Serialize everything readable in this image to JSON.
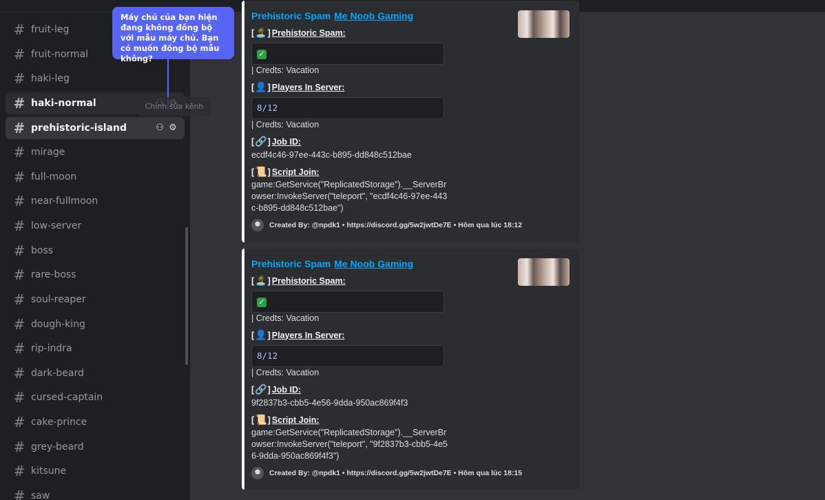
{
  "sidebar": {
    "channels": [
      {
        "name": "fruit-leg"
      },
      {
        "name": "fruit-normal"
      },
      {
        "name": "haki-leg"
      },
      {
        "name": "haki-normal"
      },
      {
        "name": "prehistoric-island"
      },
      {
        "name": "mirage"
      },
      {
        "name": "full-moon"
      },
      {
        "name": "near-fullmoon"
      },
      {
        "name": "low-server"
      },
      {
        "name": "boss"
      },
      {
        "name": "rare-boss"
      },
      {
        "name": "soul-reaper"
      },
      {
        "name": "dough-king"
      },
      {
        "name": "rip-indra"
      },
      {
        "name": "dark-beard"
      },
      {
        "name": "cursed-captain"
      },
      {
        "name": "cake-prince"
      },
      {
        "name": "grey-beard"
      },
      {
        "name": "kitsune"
      },
      {
        "name": "saw"
      }
    ],
    "hash_symbol": "#",
    "tooltip": "Chỉnh sửa kênh"
  },
  "popup": {
    "text": "Máy chủ của bạn hiện đang không đồng bộ với mẫu máy chủ. Bạn có muốn đồng bộ mẫu không?"
  },
  "messages": [
    {
      "author": "Prehistoric Spam",
      "author_link": "Me Noob Gaming",
      "spam_label": "Prehistoric Spam:",
      "spam_emoji": "🏝️",
      "spam_value": "✓",
      "credits1": "| Credts: Vacation",
      "players_label": "Players In Server:",
      "players_emoji": "👤",
      "players_value": "8/12",
      "credits2": "| Credts: Vacation",
      "job_label": "Job ID:",
      "job_emoji": "🔗",
      "job_id": "ecdf4c46-97ee-443c-b895-dd848c512bae",
      "script_label": "Script Join:",
      "script_emoji": "📜",
      "script": "game:GetService(\"ReplicatedStorage\").__ServerBrowser:InvokeServer(\"teleport\", \"ecdf4c46-97ee-443c-b895-dd848c512bae\")",
      "footer": "Created By: @npdk1 • https://discord.gg/5w2jwtDe7E • Hôm qua lúc 18:12"
    },
    {
      "author": "Prehistoric Spam",
      "author_link": "Me Noob Gaming",
      "spam_label": "Prehistoric Spam:",
      "spam_emoji": "🏝️",
      "spam_value": "✓",
      "credits1": "| Credts: Vacation",
      "players_label": "Players In Server:",
      "players_emoji": "👤",
      "players_value": "8/12",
      "credits2": "| Credts: Vacation",
      "job_label": "Job ID:",
      "job_emoji": "🔗",
      "job_id": "9f2837b3-cbb5-4e56-9dda-950ac869f4f3",
      "script_label": "Script Join:",
      "script_emoji": "📜",
      "script": "game:GetService(\"ReplicatedStorage\").__ServerBrowser:InvokeServer(\"teleport\", \"9f2837b3-cbb5-4e56-9dda-950ac869f4f3\")",
      "footer": "Created By: @npdk1 • https://discord.gg/5w2jwtDe7E • Hôm qua lúc 18:15"
    }
  ],
  "colors": {
    "sidebar_bg": "#1e1f22",
    "chat_bg": "#313338",
    "embed_bg": "#2b2d31",
    "accent_blue": "#00a8fc",
    "popup_blue": "#5865f2"
  },
  "icons": {
    "add_member": "add-member-icon",
    "settings": "gear-icon"
  }
}
